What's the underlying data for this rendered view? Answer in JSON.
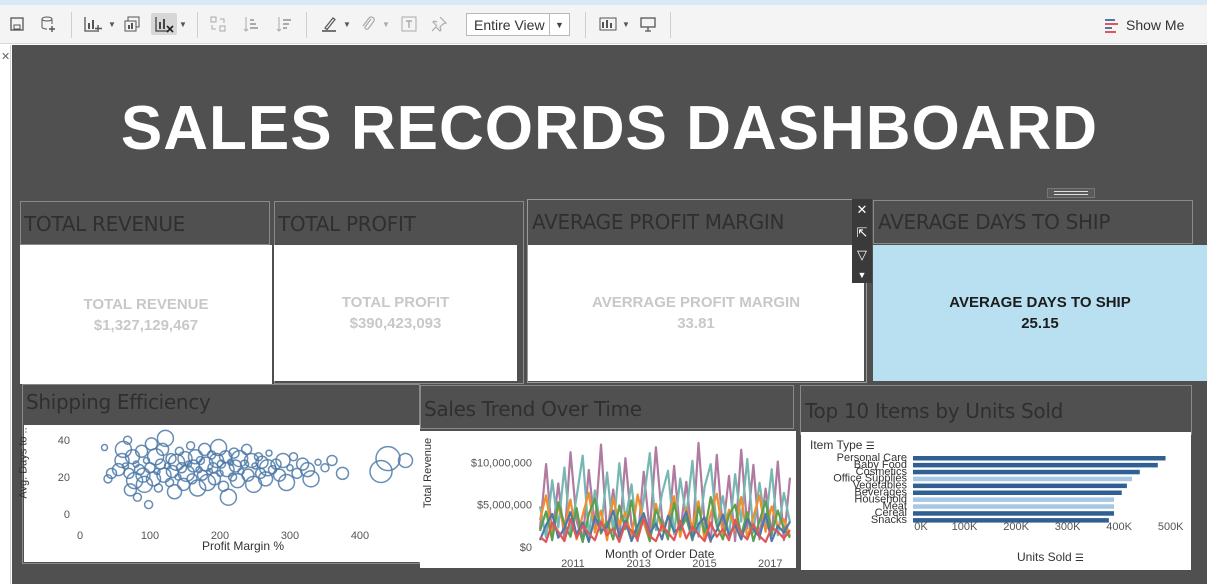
{
  "toolbar": {
    "fit_mode": "Entire View",
    "show_me_label": "Show Me"
  },
  "dashboard": {
    "title": "SALES RECORDS DASHBOARD",
    "kpis": [
      {
        "header": "TOTAL REVENUE",
        "label": "TOTAL REVENUE",
        "value": "$1,327,129,467"
      },
      {
        "header": "TOTAL PROFIT",
        "label": "TOTAL PROFIT",
        "value": "$390,423,093"
      },
      {
        "header": "AVERAGE PROFIT MARGIN",
        "label": "AVERRAGE PROFIT MARGIN",
        "value": "33.81"
      },
      {
        "header": "AVERAGE DAYS TO SHIP",
        "label": "AVERAGE DAYS TO SHIP",
        "value": "25.15"
      }
    ],
    "panels": {
      "shipping": {
        "title": "Shipping Efficiency",
        "xlabel": "Profit Margin %",
        "ylabel": "Avg. Days to .."
      },
      "trend": {
        "title": "Sales Trend Over Time",
        "xlabel": "Month of Order Date",
        "ylabel": "Total Revenue"
      },
      "top10": {
        "title": "Top 10 Items by Units Sold",
        "row_header": "Item Type",
        "xlabel": "Units Sold"
      }
    }
  },
  "colors": {
    "canvas": "#505050",
    "highlight_kpi": "#b9e0f0",
    "scatter": "#4e79a7",
    "bar_dark": "#2f5f93",
    "bar_light": "#a6c8e4"
  },
  "chart_data": [
    {
      "type": "scatter",
      "xlabel": "Profit Margin %",
      "ylabel": "Avg. Days to ..",
      "xlim": [
        0,
        480
      ],
      "ylim": [
        -5,
        45
      ],
      "xticks": [
        0,
        100,
        200,
        300,
        400
      ],
      "yticks": [
        0,
        20,
        40
      ],
      "points": [
        [
          35,
          36
        ],
        [
          40,
          19
        ],
        [
          45,
          22
        ],
        [
          55,
          24
        ],
        [
          60,
          29
        ],
        [
          62,
          35
        ],
        [
          65,
          26
        ],
        [
          68,
          40
        ],
        [
          70,
          22
        ],
        [
          72,
          13
        ],
        [
          75,
          31
        ],
        [
          78,
          18
        ],
        [
          80,
          27
        ],
        [
          82,
          9
        ],
        [
          85,
          24
        ],
        [
          88,
          34
        ],
        [
          90,
          21
        ],
        [
          92,
          16
        ],
        [
          95,
          29
        ],
        [
          98,
          5
        ],
        [
          100,
          25
        ],
        [
          102,
          38
        ],
        [
          105,
          19
        ],
        [
          108,
          31
        ],
        [
          110,
          23
        ],
        [
          112,
          14
        ],
        [
          115,
          27
        ],
        [
          118,
          35
        ],
        [
          120,
          21
        ],
        [
          122,
          41
        ],
        [
          125,
          26
        ],
        [
          128,
          17
        ],
        [
          130,
          30
        ],
        [
          132,
          23
        ],
        [
          135,
          12
        ],
        [
          138,
          28
        ],
        [
          140,
          20
        ],
        [
          142,
          34
        ],
        [
          145,
          25
        ],
        [
          148,
          16
        ],
        [
          150,
          30
        ],
        [
          152,
          22
        ],
        [
          155,
          27
        ],
        [
          158,
          37
        ],
        [
          160,
          19
        ],
        [
          162,
          26
        ],
        [
          165,
          31
        ],
        [
          168,
          14
        ],
        [
          170,
          24
        ],
        [
          172,
          29
        ],
        [
          175,
          21
        ],
        [
          178,
          35
        ],
        [
          180,
          27
        ],
        [
          182,
          17
        ],
        [
          185,
          23
        ],
        [
          188,
          32
        ],
        [
          190,
          25
        ],
        [
          192,
          19
        ],
        [
          195,
          29
        ],
        [
          198,
          36
        ],
        [
          200,
          22
        ],
        [
          202,
          27
        ],
        [
          205,
          15
        ],
        [
          208,
          31
        ],
        [
          210,
          24
        ],
        [
          212,
          9
        ],
        [
          215,
          28
        ],
        [
          218,
          20
        ],
        [
          220,
          33
        ],
        [
          222,
          26
        ],
        [
          225,
          18
        ],
        [
          228,
          30
        ],
        [
          230,
          23
        ],
        [
          235,
          27
        ],
        [
          238,
          35
        ],
        [
          240,
          21
        ],
        [
          245,
          29
        ],
        [
          248,
          16
        ],
        [
          250,
          26
        ],
        [
          255,
          31
        ],
        [
          258,
          22
        ],
        [
          260,
          28
        ],
        [
          265,
          19
        ],
        [
          268,
          25
        ],
        [
          270,
          33
        ],
        [
          275,
          24
        ],
        [
          280,
          27
        ],
        [
          285,
          21
        ],
        [
          290,
          29
        ],
        [
          295,
          17
        ],
        [
          300,
          25
        ],
        [
          305,
          31
        ],
        [
          310,
          22
        ],
        [
          318,
          27
        ],
        [
          325,
          24
        ],
        [
          330,
          19
        ],
        [
          340,
          28
        ],
        [
          350,
          25
        ],
        [
          360,
          29
        ],
        [
          375,
          22
        ],
        [
          430,
          23
        ],
        [
          440,
          30
        ],
        [
          465,
          29
        ]
      ]
    },
    {
      "type": "line",
      "xlabel": "Month of Order Date",
      "ylabel": "Total Revenue",
      "xticks": [
        "2011",
        "2013",
        "2015",
        "2017"
      ],
      "yticks": [
        "$0",
        "$5,000,000",
        "$10,000,000"
      ],
      "ylim": [
        0,
        13000000
      ],
      "x_range": [
        2010.0,
        2017.6
      ],
      "series": [
        {
          "color": "#b07aa1",
          "values": [
            2.1,
            9.8,
            1.2,
            7.5,
            0.8,
            11.2,
            3.1,
            0.6,
            9.1,
            2.4,
            12.1,
            1.5,
            6.8,
            0.9,
            10.5,
            2.6,
            0.7,
            8.9,
            1.8,
            11.8,
            3.4,
            0.9,
            9.6,
            1.6,
            7.7,
            0.8,
            12.3,
            2.8,
            0.6,
            10.9,
            1.9,
            8.4,
            0.7,
            11.5,
            2.2,
            9.7,
            0.9,
            6.9,
            1.4,
            10.1,
            0.8,
            8.2
          ]
        },
        {
          "color": "#76b7b2",
          "values": [
            4.8,
            1.1,
            7.9,
            2.3,
            9.4,
            1.6,
            5.9,
            10.8,
            1.3,
            6.7,
            2.1,
            8.8,
            1.7,
            9.9,
            3.2,
            7.4,
            1.0,
            5.6,
            11.1,
            2.0,
            6.3,
            9.0,
            1.5,
            8.1,
            3.6,
            10.2,
            1.2,
            7.1,
            9.8,
            2.4,
            6.0,
            1.1,
            8.6,
            3.0,
            10.4,
            1.7,
            7.6,
            2.6,
            9.2,
            1.4,
            6.4,
            2.9
          ]
        },
        {
          "color": "#f28e2b",
          "values": [
            3.2,
            6.1,
            1.4,
            4.9,
            2.2,
            5.6,
            0.9,
            3.8,
            6.4,
            1.7,
            4.3,
            0.8,
            5.8,
            2.6,
            4.1,
            1.0,
            6.2,
            2.9,
            0.7,
            5.1,
            1.9,
            3.5,
            6.0,
            1.2,
            4.6,
            2.3,
            5.4,
            0.9,
            3.9,
            6.3,
            1.5,
            4.4,
            2.0,
            5.9,
            1.1,
            3.6,
            6.1,
            1.8,
            4.8,
            2.4,
            3.3,
            1.3
          ]
        },
        {
          "color": "#59a14f",
          "values": [
            1.9,
            4.2,
            0.8,
            5.3,
            2.7,
            1.2,
            4.6,
            0.6,
            3.9,
            5.7,
            1.6,
            3.0,
            0.9,
            4.9,
            2.1,
            5.5,
            1.3,
            3.7,
            0.7,
            4.4,
            2.8,
            1.0,
            5.2,
            2.0,
            3.4,
            0.8,
            4.7,
            1.7,
            5.9,
            2.5,
            0.9,
            3.8,
            5.0,
            1.4,
            4.1,
            0.7,
            3.1,
            5.4,
            1.6,
            4.3,
            2.2,
            1.1
          ]
        },
        {
          "color": "#4e79a7",
          "values": [
            0.8,
            2.6,
            3.9,
            1.1,
            2.2,
            4.1,
            1.5,
            2.9,
            0.6,
            3.6,
            1.9,
            2.4,
            4.3,
            1.2,
            3.1,
            0.7,
            2.5,
            4.0,
            1.6,
            2.8,
            0.9,
            3.7,
            1.8,
            2.3,
            4.2,
            1.0,
            2.7,
            3.5,
            0.8,
            2.0,
            3.8,
            1.4,
            2.6,
            0.9,
            3.3,
            2.1,
            1.2,
            3.9,
            0.7,
            2.5,
            1.7,
            3.0
          ]
        },
        {
          "color": "#e15759",
          "values": [
            1.2,
            0.6,
            2.9,
            1.8,
            0.7,
            3.3,
            1.1,
            2.5,
            1.6,
            0.8,
            3.0,
            1.4,
            2.2,
            0.6,
            2.8,
            1.9,
            0.9,
            3.4,
            1.3,
            0.7,
            2.6,
            1.7,
            0.8,
            3.1,
            1.0,
            2.4,
            1.5,
            0.7,
            2.9,
            1.2,
            2.1,
            0.8,
            3.2,
            1.6,
            0.9,
            2.7,
            1.3,
            0.6,
            2.3,
            1.8,
            1.0,
            2.0
          ]
        }
      ],
      "value_unit": "millions"
    },
    {
      "type": "bar",
      "orientation": "horizontal",
      "row_header": "Item Type",
      "xlabel": "Units Sold",
      "xticks": [
        "0K",
        "100K",
        "200K",
        "300K",
        "400K",
        "500K"
      ],
      "xlim": [
        0,
        520000
      ],
      "categories": [
        "Personal Care",
        "Baby Food",
        "Cosmetics",
        "Office Supplies",
        "Vegetables",
        "Beverages",
        "Household",
        "Meat",
        "Cereal",
        "Snacks"
      ],
      "values": [
        490000,
        475000,
        440000,
        425000,
        415000,
        405000,
        390000,
        390000,
        390000,
        380000
      ],
      "shades": [
        "dark",
        "dark",
        "dark",
        "light",
        "dark",
        "dark",
        "light",
        "light",
        "dark",
        "dark"
      ]
    }
  ]
}
